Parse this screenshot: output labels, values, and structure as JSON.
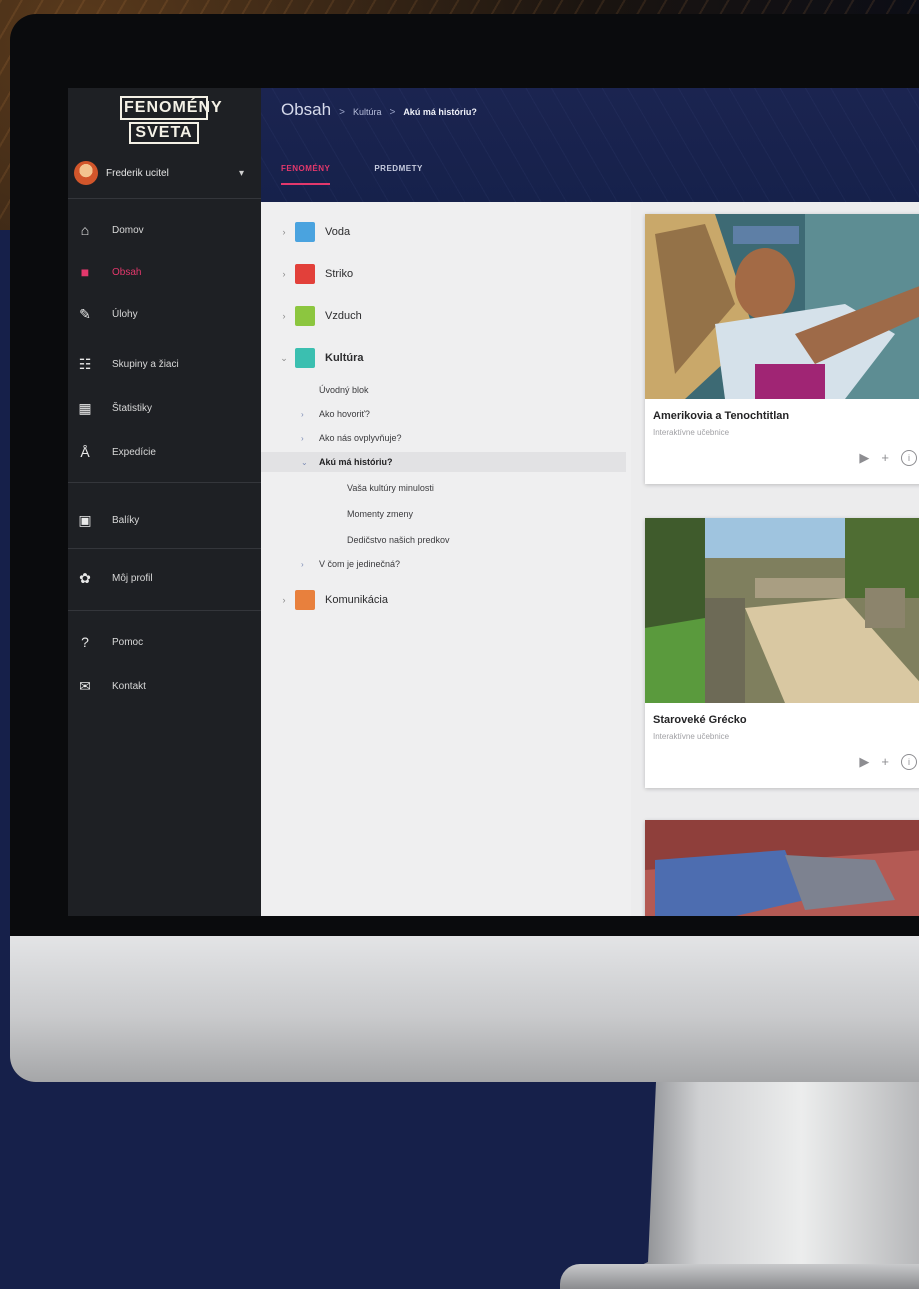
{
  "app": {
    "logo_line1": "FENOMÉNY",
    "logo_line2": "SVETA",
    "user_name": "Frederik ucitel"
  },
  "sidebar": {
    "items": [
      {
        "label": "Domov",
        "icon": "home-icon"
      },
      {
        "label": "Obsah",
        "icon": "content-icon",
        "active": true
      },
      {
        "label": "Úlohy",
        "icon": "pencil-icon"
      },
      {
        "label": "Skupiny a žiaci",
        "icon": "group-icon"
      },
      {
        "label": "Štatistiky",
        "icon": "stats-icon"
      },
      {
        "label": "Expedície",
        "icon": "expedition-icon"
      },
      {
        "label": "Balíky",
        "icon": "package-icon"
      },
      {
        "label": "Môj profil",
        "icon": "gear-icon"
      },
      {
        "label": "Pomoc",
        "icon": "help-icon"
      },
      {
        "label": "Kontakt",
        "icon": "mail-icon"
      }
    ]
  },
  "header": {
    "breadcrumb": [
      "Obsah",
      "Kultúra",
      "Akú má históriu?"
    ],
    "separator": ">",
    "tabs": [
      "FENOMÉNY",
      "PREDMETY"
    ]
  },
  "tree": {
    "top": [
      {
        "label": "Voda",
        "color": "#4aa3df"
      },
      {
        "label": "Striko",
        "color": "#e2403a"
      },
      {
        "label": "Vzduch",
        "color": "#8cc63f"
      },
      {
        "label": "Kultúra",
        "color": "#3bbfb0"
      }
    ],
    "kultura_children": [
      {
        "label": "Úvodný blok"
      },
      {
        "label": "Ako hovoriť?"
      },
      {
        "label": "Ako nás ovplyvňuje?"
      },
      {
        "label": "Akú má históriu?",
        "selected": true
      },
      {
        "label": "Vaša kultúry minulosti"
      },
      {
        "label": "Momenty zmeny"
      },
      {
        "label": "Dedičstvo našich predkov"
      },
      {
        "label": "V čom je jedinečná?"
      }
    ],
    "last": {
      "label": "Komunikácia",
      "color": "#e8803d"
    }
  },
  "cards": [
    {
      "title": "Amerikovia a Tenochtitlan",
      "subtitle": "Interaktívne učebnice"
    },
    {
      "title": "Staroveké Grécko",
      "subtitle": "Interaktívne učebnice"
    },
    {
      "title": "",
      "subtitle": ""
    }
  ],
  "icons": {
    "play": "▶",
    "plus": "+",
    "info": "i",
    "arrow_right": "›",
    "arrow_down": "⌄",
    "bullet": "•",
    "caret": "▾"
  }
}
